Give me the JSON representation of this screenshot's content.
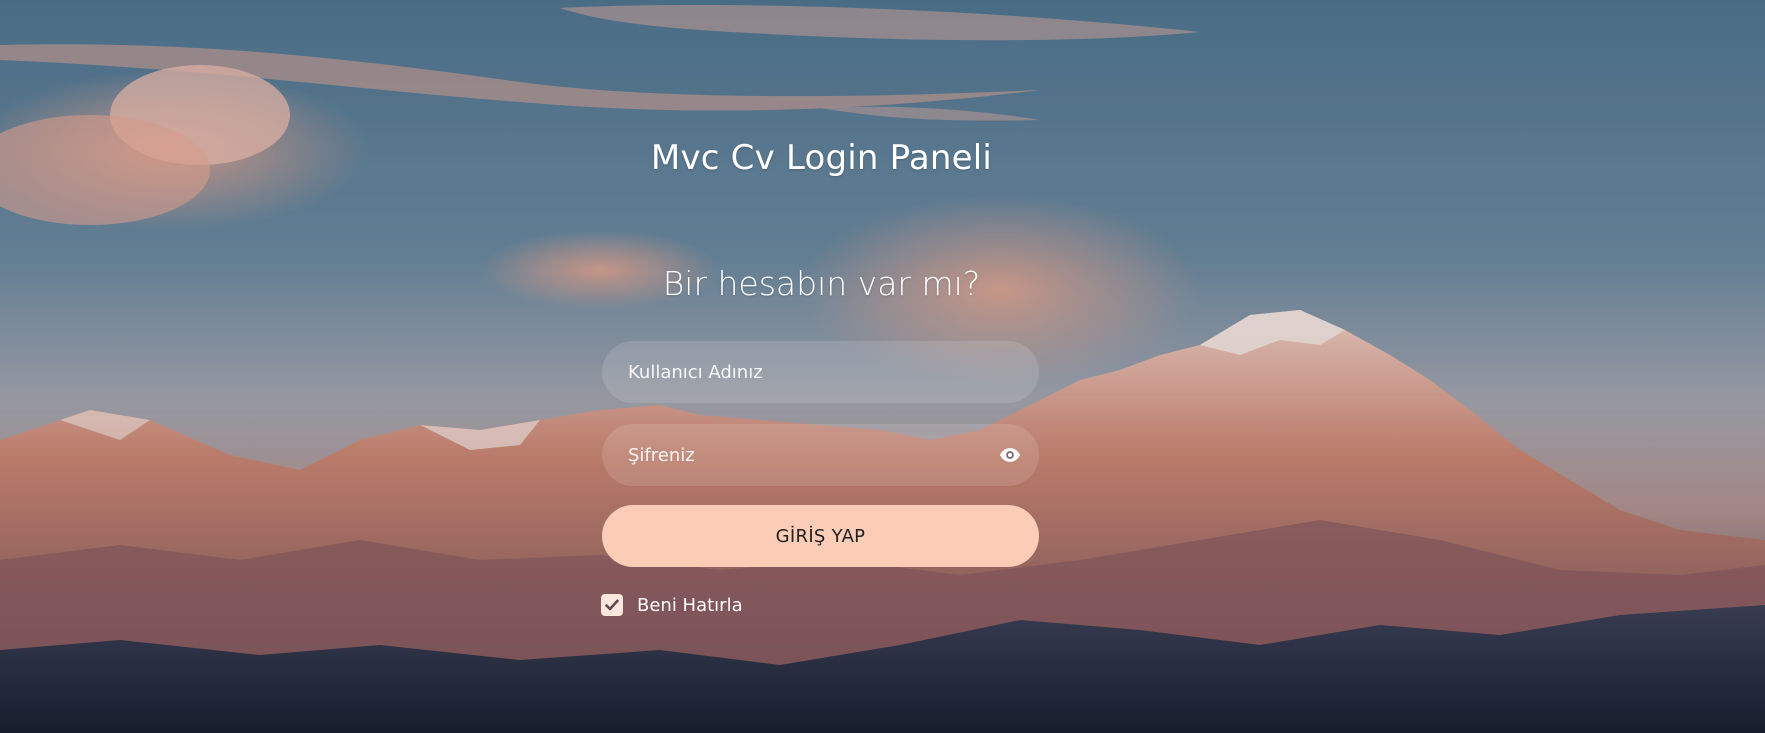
{
  "page": {
    "title": "Mvc Cv Login Paneli",
    "subtitle": "Bir hesabın var mı?"
  },
  "form": {
    "username_placeholder": "Kullanıcı Adınız",
    "username_value": "",
    "password_placeholder": "Şifreniz",
    "password_value": "",
    "submit_label": "GİRİŞ YAP",
    "remember_label": "Beni Hatırla",
    "remember_checked": true
  },
  "icons": {
    "password_toggle": "eye-icon",
    "remember_check": "check-icon"
  },
  "colors": {
    "button_bg": "#fccdb6",
    "field_bg": "rgba(255,255,255,0.13)",
    "text": "#ffffff"
  }
}
